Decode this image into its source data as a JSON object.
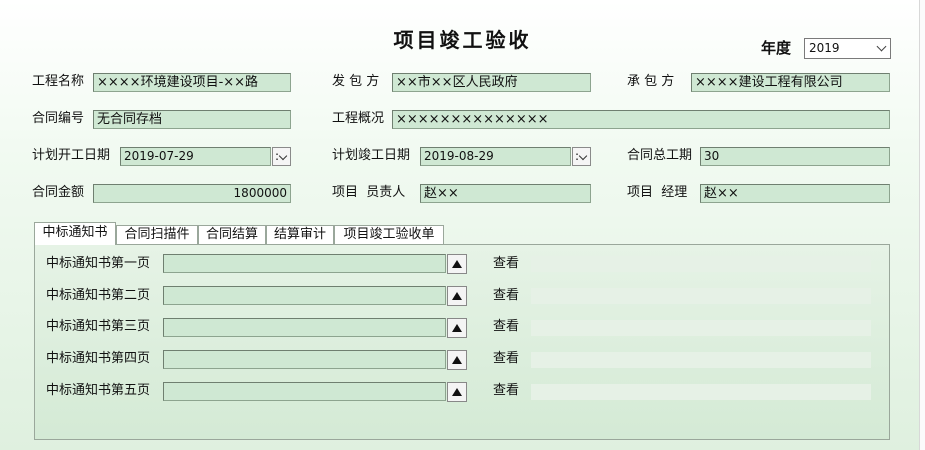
{
  "title": "项目竣工验收",
  "year": {
    "label": "年度",
    "value": "2019"
  },
  "fields": {
    "project_name": {
      "label": "工程名称",
      "value": "××××环境建设项目-××路"
    },
    "issuer": {
      "label": "发 包 方",
      "value": "××市××区人民政府"
    },
    "contractor": {
      "label": "承 包 方",
      "value": "××××建设工程有限公司"
    },
    "contract_no": {
      "label": "合同编号",
      "value": "无合同存档"
    },
    "overview": {
      "label": "工程概况",
      "value": "××××××××××××××"
    },
    "plan_start": {
      "label": "计划开工日期",
      "value": "2019-07-29"
    },
    "plan_end": {
      "label": "计划竣工日期",
      "value": "2019-08-29"
    },
    "total_period": {
      "label": "合同总工期",
      "value": "30"
    },
    "amount": {
      "label": "合同金额",
      "value": "1800000"
    },
    "responsible": {
      "label": "项目  员责人",
      "value": "赵××"
    },
    "manager": {
      "label": "项目  经理",
      "value": "赵××"
    }
  },
  "tabs": [
    "中标通知书",
    "合同扫描件",
    "合同结算",
    "结算审计",
    "项目竣工验收单"
  ],
  "pages": [
    {
      "label": "中标通知书第一页",
      "view": "查看",
      "value": ""
    },
    {
      "label": "中标通知书第二页",
      "view": "查看",
      "value": ""
    },
    {
      "label": "中标通知书第三页",
      "view": "查看",
      "value": ""
    },
    {
      "label": "中标通知书第四页",
      "view": "查看",
      "value": ""
    },
    {
      "label": "中标通知书第五页",
      "view": "查看",
      "value": ""
    }
  ]
}
